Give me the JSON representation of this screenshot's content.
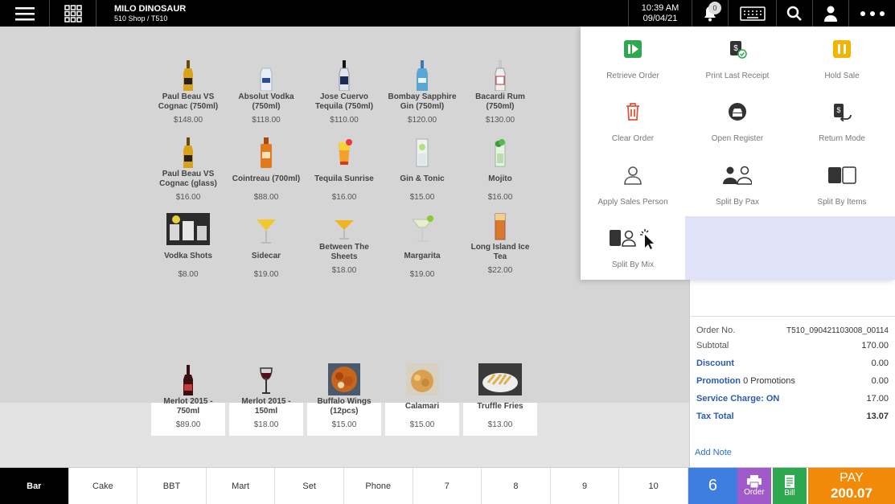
{
  "header": {
    "user_name": "MILO DINOSAUR",
    "shop": "510 Shop / T510",
    "time": "10:39 AM",
    "date": "09/04/21",
    "notifications": "0"
  },
  "products": [
    {
      "name": "Paul Beau VS Cognac (750ml)",
      "price": "$148.00",
      "icon": "cognac-bottle-icon"
    },
    {
      "name": "Absolut Vodka (750ml)",
      "price": "$118.00",
      "icon": "vodka-bottle-icon"
    },
    {
      "name": "Jose Cuervo Tequila (750ml)",
      "price": "$110.00",
      "icon": "tequila-bottle-icon"
    },
    {
      "name": "Bombay Sapphire Gin (750ml)",
      "price": "$120.00",
      "icon": "gin-bottle-icon"
    },
    {
      "name": "Bacardi Rum (750ml)",
      "price": "$130.00",
      "icon": "rum-bottle-icon"
    },
    {
      "name": "Paul Beau VS Cognac (glass)",
      "price": "$16.00",
      "icon": "cognac-bottle-icon"
    },
    {
      "name": "Cointreau (700ml)",
      "price": "$88.00",
      "icon": "cointreau-bottle-icon"
    },
    {
      "name": "Tequila Sunrise",
      "price": "$16.00",
      "icon": "cocktail-icon"
    },
    {
      "name": "Gin & Tonic",
      "price": "$15.00",
      "icon": "highball-icon"
    },
    {
      "name": "Mojito",
      "price": "$16.00",
      "icon": "mojito-icon"
    },
    {
      "name": "Vodka Shots",
      "price": "$8.00",
      "icon": "shots-photo"
    },
    {
      "name": "Sidecar",
      "price": "$19.00",
      "icon": "martini-icon"
    },
    {
      "name": "Between The Sheets",
      "price": "$18.00",
      "icon": "martini-icon"
    },
    {
      "name": "Margarita",
      "price": "$19.00",
      "icon": "margarita-icon"
    },
    {
      "name": "Long Island Ice Tea",
      "price": "$22.00",
      "icon": "highball-icon"
    },
    {
      "name": "Merlot 2015 - 750ml",
      "price": "$89.00",
      "icon": "wine-bottle-icon"
    },
    {
      "name": "Merlot 2015 - 150ml",
      "price": "$18.00",
      "icon": "wine-glass-icon"
    },
    {
      "name": "Buffalo Wings (12pcs)",
      "price": "$15.00",
      "icon": "wings-photo"
    },
    {
      "name": "Calamari",
      "price": "$15.00",
      "icon": "calamari-photo"
    },
    {
      "name": "Truffle Fries",
      "price": "$13.00",
      "icon": "fries-photo"
    }
  ],
  "menu": [
    {
      "label": "Retrieve Order",
      "icon": "retrieve-order-icon",
      "color": "#2ea84f"
    },
    {
      "label": "Print Last Receipt",
      "icon": "print-receipt-icon",
      "color": "#333333"
    },
    {
      "label": "Hold Sale",
      "icon": "hold-sale-icon",
      "color": "#f2b400"
    },
    {
      "label": "Clear Order",
      "icon": "trash-icon",
      "color": "#e0553a"
    },
    {
      "label": "Open Register",
      "icon": "register-icon",
      "color": "#333333"
    },
    {
      "label": "Return Mode",
      "icon": "return-mode-icon",
      "color": "#333333"
    },
    {
      "label": "Apply Sales Person",
      "icon": "person-icon",
      "color": "#555555"
    },
    {
      "label": "Split By Pax",
      "icon": "split-pax-icon",
      "color": "#333333"
    },
    {
      "label": "Split By Items",
      "icon": "split-items-icon",
      "color": "#333333"
    },
    {
      "label": "Split By Mix",
      "icon": "split-mix-icon",
      "color": "#333333"
    }
  ],
  "order": {
    "order_no_label": "Order No.",
    "order_no": "T510_090421103008_00114",
    "subtotal_label": "Subtotal",
    "subtotal": "170.00",
    "discount_label": "Discount",
    "discount": "0.00",
    "promotion_label": "Promotion",
    "promotion_count": "0 Promotions",
    "promotion": "0.00",
    "service_label": "Service Charge: ON",
    "service": "17.00",
    "tax_label": "Tax Total",
    "tax": "13.07",
    "add_note": "Add Note"
  },
  "categories": [
    "Bar",
    "Cake",
    "BBT",
    "Mart",
    "Set",
    "Phone",
    "7",
    "8",
    "9",
    "10"
  ],
  "actions": {
    "quantity": "6",
    "order_label": "Order",
    "bill_label": "Bill",
    "pay_label": "PAY",
    "pay_total": "200.07"
  },
  "colors": {
    "pay": "#f08a08",
    "qty": "#3d7ee0",
    "order": "#a05ac9",
    "bill": "#2ea84f"
  }
}
